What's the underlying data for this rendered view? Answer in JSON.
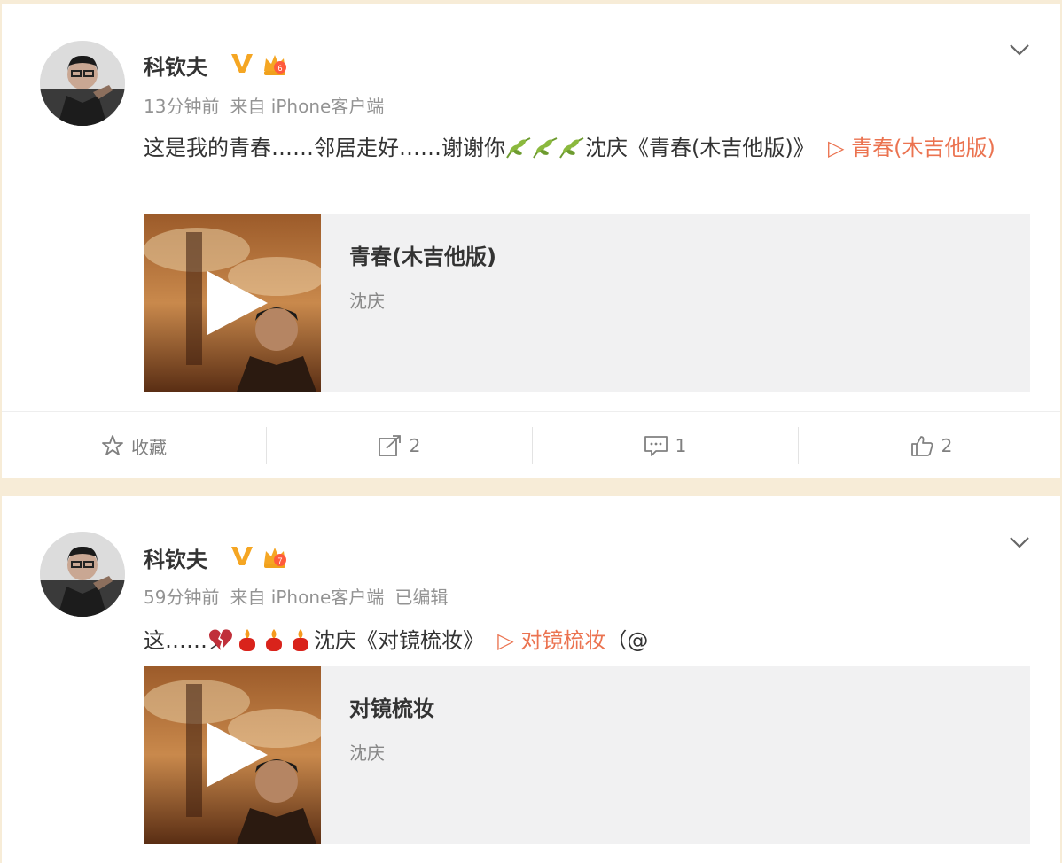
{
  "posts": [
    {
      "user": {
        "name": "科钦夫"
      },
      "meta": {
        "time": "13分钟前",
        "source": "来自 iPhone客户端"
      },
      "text": {
        "part1": "这是我的青春……邻居走好……谢谢你",
        "part2": "沈庆《青春(木吉他版)》",
        "link_prefix": "▷ ",
        "link": "青春(木吉他版)",
        "emojis": [
          "leaf-icon",
          "leaf-icon",
          "leaf-icon"
        ]
      },
      "music": {
        "title": "青春(木吉他版)",
        "artist": "沈庆"
      },
      "actions": {
        "favorite": "收藏",
        "repost": "2",
        "comment": "1",
        "like": "2"
      }
    },
    {
      "user": {
        "name": "科钦夫"
      },
      "meta": {
        "time": "59分钟前",
        "source": "来自 iPhone客户端",
        "edited": "已编辑"
      },
      "text": {
        "part1": "这……",
        "part2": "沈庆《对镜梳妆》",
        "link_prefix": "▷ ",
        "link": "对镜梳妆",
        "tail": "（@",
        "emojis": [
          "broken-heart-icon",
          "candle-icon",
          "candle-icon",
          "candle-icon"
        ]
      },
      "music": {
        "title": "对镜梳妆",
        "artist": "沈庆"
      }
    }
  ],
  "colors": {
    "link": "#eb7350",
    "verified": "#f5a623",
    "background": "#f7ecd7"
  }
}
